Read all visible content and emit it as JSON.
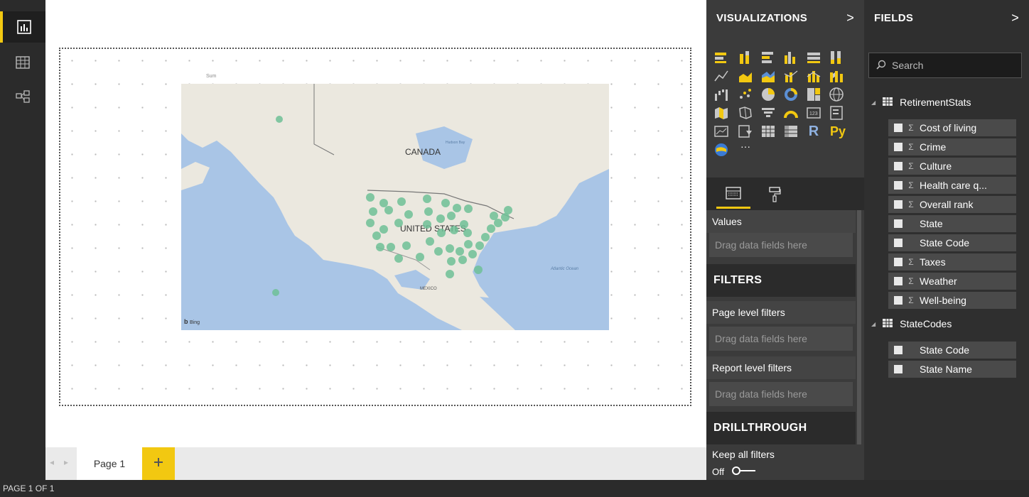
{
  "nav": {
    "items": [
      {
        "icon": "report-view-icon",
        "active": true
      },
      {
        "icon": "data-view-icon",
        "active": false
      },
      {
        "icon": "relationships-view-icon",
        "active": false
      }
    ]
  },
  "canvas": {
    "visual_title": "Sum",
    "map": {
      "labels": {
        "canada": "CANADA",
        "united_states": "UNITED STATES",
        "mexico": "MEXICO",
        "hudson_bay": "Hudson Bay",
        "atlantic_ocean": "Atlantic Ocean",
        "bing": "Bing"
      }
    }
  },
  "page_tabs": {
    "tabs": [
      {
        "label": "Page 1",
        "active": true
      }
    ],
    "add_label": "+"
  },
  "status_bar": {
    "text": "PAGE 1 OF 1"
  },
  "visualizations": {
    "title": "VISUALIZATIONS",
    "chevron": ">",
    "icons": [
      "stacked-bar-icon",
      "stacked-column-icon",
      "clustered-bar-icon",
      "clustered-column-icon",
      "100-stacked-bar-icon",
      "100-stacked-column-icon",
      "line-chart-icon",
      "area-chart-icon",
      "stacked-area-icon",
      "line-clustered-column-icon",
      "line-stacked-column-icon",
      "ribbon-chart-icon",
      "waterfall-icon",
      "scatter-icon",
      "pie-chart-icon",
      "donut-chart-icon",
      "treemap-icon",
      "map-icon",
      "filled-map-icon",
      "shape-map-icon",
      "funnel-icon",
      "gauge-icon",
      "card-icon",
      "multi-row-card-icon",
      "kpi-icon",
      "slicer-icon",
      "table-icon",
      "matrix-icon",
      "r-visual-icon",
      "python-visual-icon",
      "arcgis-icon",
      "more-visuals-icon"
    ],
    "r_label": "R",
    "py_label": "Py",
    "more_label": "···",
    "tabs": [
      {
        "icon": "fields-tab-icon",
        "active": true
      },
      {
        "icon": "format-paint-roller-icon",
        "active": false
      }
    ],
    "values_label": "Values",
    "drag_text": "Drag data fields here"
  },
  "filters": {
    "title": "FILTERS",
    "page_level_label": "Page level filters",
    "report_level_label": "Report level filters",
    "drag_text": "Drag data fields here"
  },
  "drillthrough": {
    "title": "DRILLTHROUGH",
    "keep_all_filters_label": "Keep all filters",
    "toggle_state": "Off"
  },
  "fields": {
    "title": "FIELDS",
    "chevron": ">",
    "search_placeholder": "Search",
    "tables": [
      {
        "name": "RetirementStats",
        "fields": [
          {
            "name": "Cost of living",
            "sigma": true
          },
          {
            "name": "Crime",
            "sigma": true
          },
          {
            "name": "Culture",
            "sigma": true
          },
          {
            "name": "Health care q...",
            "sigma": true
          },
          {
            "name": "Overall rank",
            "sigma": true
          },
          {
            "name": "State",
            "sigma": false
          },
          {
            "name": "State Code",
            "sigma": false
          },
          {
            "name": "Taxes",
            "sigma": true
          },
          {
            "name": "Weather",
            "sigma": true
          },
          {
            "name": "Well-being",
            "sigma": true
          }
        ]
      },
      {
        "name": "StateCodes",
        "fields": [
          {
            "name": "State Code",
            "sigma": false
          },
          {
            "name": "State Name",
            "sigma": false
          }
        ]
      }
    ]
  },
  "colors": {
    "accent": "#f2c811",
    "pane_dark": "#3b3b3b",
    "map_water": "#a9c5e6",
    "map_land": "#ebe8df",
    "bubble": "#6fbf96"
  }
}
